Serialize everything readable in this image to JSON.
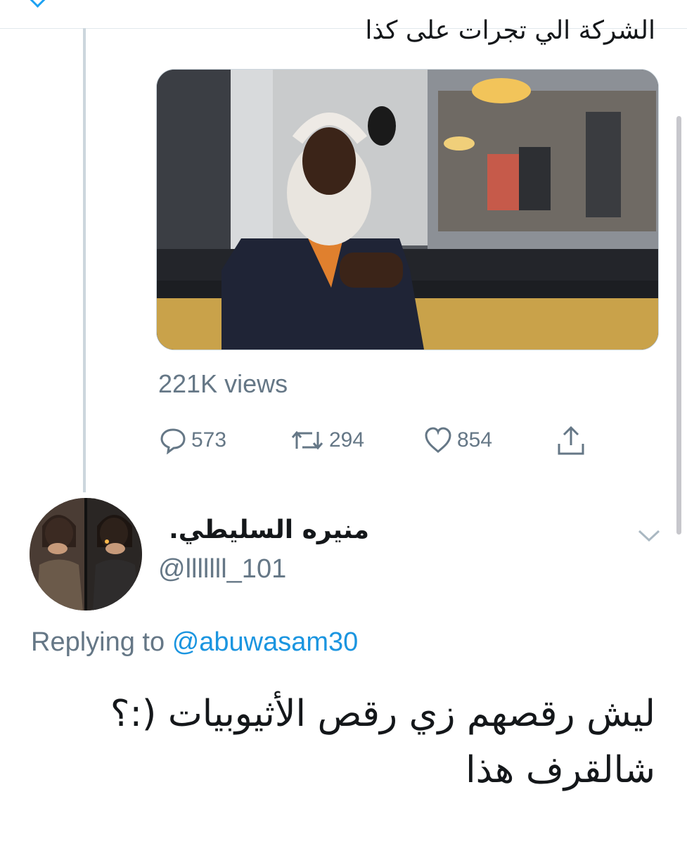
{
  "parent_tweet": {
    "text_partial": "الشركة الي تجرات على كذا",
    "views": "221K views",
    "actions": {
      "reply_count": "573",
      "retweet_count": "294",
      "like_count": "854"
    }
  },
  "reply_tweet": {
    "display_name": "منيره السليطي.",
    "handle": "@lllllll_101",
    "replying_prefix": "Replying to",
    "replying_to": "@abuwasam30",
    "text_line1": "ليش رقصهم زي رقص الأثيوبيات (:؟",
    "text_line2": "شالقرف هذا"
  },
  "icons": {
    "reply": "reply-icon",
    "retweet": "retweet-icon",
    "like": "heart-icon",
    "share": "share-icon",
    "more": "chevron-down-icon"
  },
  "colors": {
    "accent": "#1da1f2",
    "mention": "#1b95e0",
    "secondary_text": "#657786",
    "primary_text": "#14171a"
  }
}
